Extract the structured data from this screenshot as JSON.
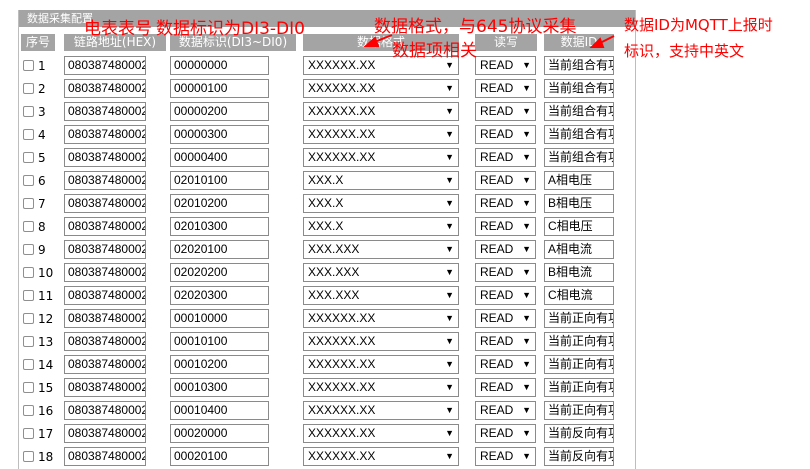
{
  "panel_title": "数据采集配置",
  "columns": {
    "index": "序号",
    "address": "链路地址(HEX)",
    "identifier": "数据标识(DI3~DI0)",
    "format": "数据格式",
    "rw": "读写",
    "data_id": "数据ID"
  },
  "rows": [
    {
      "n": "1",
      "address": "080387480002",
      "identifier": "00000000",
      "format": "XXXXXX.XX",
      "rw": "READ",
      "data_id": "当前组合有功"
    },
    {
      "n": "2",
      "address": "080387480002",
      "identifier": "00000100",
      "format": "XXXXXX.XX",
      "rw": "READ",
      "data_id": "当前组合有功"
    },
    {
      "n": "3",
      "address": "080387480002",
      "identifier": "00000200",
      "format": "XXXXXX.XX",
      "rw": "READ",
      "data_id": "当前组合有功"
    },
    {
      "n": "4",
      "address": "080387480002",
      "identifier": "00000300",
      "format": "XXXXXX.XX",
      "rw": "READ",
      "data_id": "当前组合有功"
    },
    {
      "n": "5",
      "address": "080387480002",
      "identifier": "00000400",
      "format": "XXXXXX.XX",
      "rw": "READ",
      "data_id": "当前组合有功"
    },
    {
      "n": "6",
      "address": "080387480002",
      "identifier": "02010100",
      "format": "XXX.X",
      "rw": "READ",
      "data_id": "A相电压"
    },
    {
      "n": "7",
      "address": "080387480002",
      "identifier": "02010200",
      "format": "XXX.X",
      "rw": "READ",
      "data_id": "B相电压"
    },
    {
      "n": "8",
      "address": "080387480002",
      "identifier": "02010300",
      "format": "XXX.X",
      "rw": "READ",
      "data_id": "C相电压"
    },
    {
      "n": "9",
      "address": "080387480002",
      "identifier": "02020100",
      "format": "XXX.XXX",
      "rw": "READ",
      "data_id": "A相电流"
    },
    {
      "n": "10",
      "address": "080387480002",
      "identifier": "02020200",
      "format": "XXX.XXX",
      "rw": "READ",
      "data_id": "B相电流"
    },
    {
      "n": "11",
      "address": "080387480002",
      "identifier": "02020300",
      "format": "XXX.XXX",
      "rw": "READ",
      "data_id": "C相电流"
    },
    {
      "n": "12",
      "address": "080387480002",
      "identifier": "00010000",
      "format": "XXXXXX.XX",
      "rw": "READ",
      "data_id": "当前正向有功"
    },
    {
      "n": "13",
      "address": "080387480002",
      "identifier": "00010100",
      "format": "XXXXXX.XX",
      "rw": "READ",
      "data_id": "当前正向有功"
    },
    {
      "n": "14",
      "address": "080387480002",
      "identifier": "00010200",
      "format": "XXXXXX.XX",
      "rw": "READ",
      "data_id": "当前正向有功"
    },
    {
      "n": "15",
      "address": "080387480002",
      "identifier": "00010300",
      "format": "XXXXXX.XX",
      "rw": "READ",
      "data_id": "当前正向有功"
    },
    {
      "n": "16",
      "address": "080387480002",
      "identifier": "00010400",
      "format": "XXXXXX.XX",
      "rw": "READ",
      "data_id": "当前正向有功"
    },
    {
      "n": "17",
      "address": "080387480002",
      "identifier": "00020000",
      "format": "XXXXXX.XX",
      "rw": "READ",
      "data_id": "当前反向有功"
    },
    {
      "n": "18",
      "address": "080387480002",
      "identifier": "00020100",
      "format": "XXXXXX.XX",
      "rw": "READ",
      "data_id": "当前反向有功"
    }
  ],
  "annotations": {
    "meter_number": "电表表号",
    "data_identifier": "数据标识为DI3-DI0",
    "data_format_line1": "数据格式，与645协议采集",
    "data_format_line2": "数据项相关",
    "data_id_line1": "数据ID为MQTT上报时",
    "data_id_line2": "标识，支持中英文"
  },
  "colors": {
    "header_bg": "#a4a4a4",
    "annotation": "#ff0000"
  }
}
